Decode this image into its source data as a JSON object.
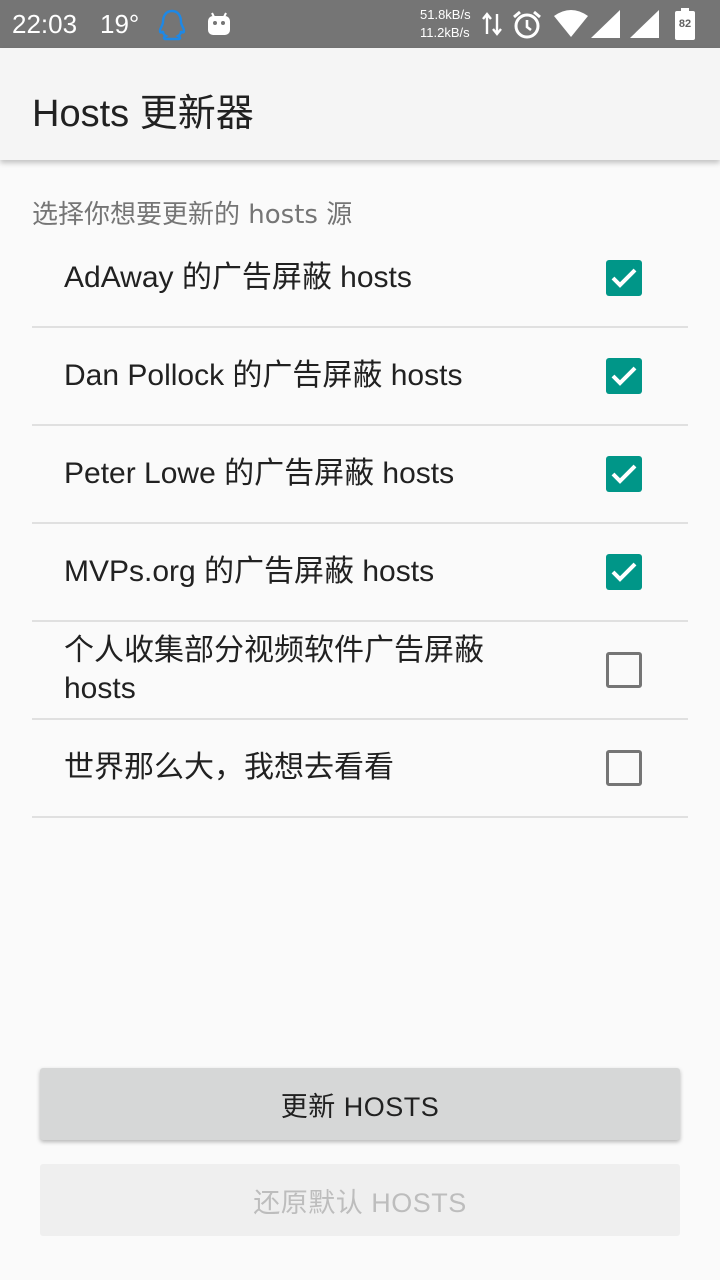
{
  "status_bar": {
    "time": "22:03",
    "temperature": "19°",
    "net_down": "51.8kB/s",
    "net_up": "11.2kB/s",
    "battery": "82",
    "icons": [
      "qq-icon",
      "android-icon",
      "data-arrows-icon",
      "alarm-icon",
      "wifi-icon",
      "signal-icon",
      "signal-icon",
      "battery-icon"
    ]
  },
  "app_bar": {
    "title": "Hosts 更新器"
  },
  "section": {
    "header": "选择你想要更新的 hosts 源"
  },
  "sources": [
    {
      "label": "AdAway 的广告屏蔽 hosts",
      "checked": true
    },
    {
      "label": "Dan Pollock 的广告屏蔽 hosts",
      "checked": true
    },
    {
      "label": "Peter Lowe 的广告屏蔽 hosts",
      "checked": true
    },
    {
      "label": "MVPs.org 的广告屏蔽 hosts",
      "checked": true
    },
    {
      "label": "个人收集部分视频软件广告屏蔽 hosts",
      "checked": false
    },
    {
      "label": "世界那么大，我想去看看",
      "checked": false
    }
  ],
  "buttons": {
    "update": "更新 HOSTS",
    "restore": "还原默认 HOSTS"
  },
  "colors": {
    "accent": "#009688",
    "status_bar": "#757575",
    "app_bar": "#f5f5f5",
    "background": "#fafafa"
  }
}
